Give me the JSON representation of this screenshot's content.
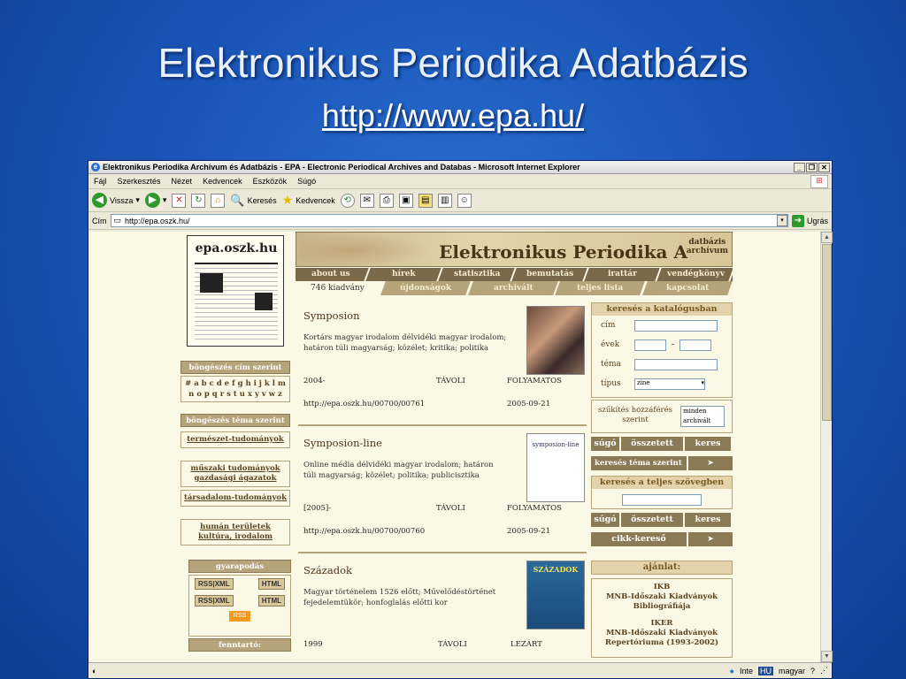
{
  "slide": {
    "title": "Elektronikus Periodika Adatbázis",
    "link": "http://www.epa.hu/"
  },
  "window": {
    "title": "Elektronikus Periodika Archívum és Adatbázis - EPA - Electronic Periodical Archives and Databas - Microsoft Internet Explorer",
    "menu": [
      "Fájl",
      "Szerkesztés",
      "Nézet",
      "Kedvencek",
      "Eszközök",
      "Súgó"
    ],
    "toolbar": {
      "back": "Vissza",
      "search": "Keresés",
      "favorites": "Kedvencek"
    },
    "address": {
      "label": "Cím",
      "url": "http://epa.oszk.hu/",
      "go": "Ugrás"
    },
    "status": {
      "zone": "Inte",
      "lang_code": "HU",
      "lang": "magyar"
    }
  },
  "site": {
    "logo_text": "epa.oszk.hu",
    "banner": {
      "title": "Elektronikus Periodika A",
      "sub1": "datbázis",
      "sub2": "archívum"
    },
    "nav_top": [
      "about us",
      "hírek",
      "statisztika",
      "bemutatás",
      "irattár",
      "vendégkönyv"
    ],
    "nav_bottom": [
      "746 kiadvány",
      "újdonságok",
      "archivált",
      "teljes lista",
      "kapcsolat"
    ],
    "left": {
      "browse_title": "böngészés cím szerint",
      "alpha1": "# a b c d e f g h i j k l m",
      "alpha2": "n o p q r s t u x y v w z",
      "browse_topic": "böngészés téma szerint",
      "topics": [
        "természet-tudományok",
        "műszaki tudományok gazdasági ágazatok",
        "társadalom-tudományok",
        "humán területek kultúra, irodalom"
      ],
      "gyarapodas": "gyarapodás",
      "rss": "RSS",
      "xml": "XML",
      "html": "HTML",
      "rss_badge": "RSS",
      "fenntarto": "fenntartó:"
    },
    "entries": [
      {
        "title": "Symposion",
        "desc": "Kortárs magyar irodalom délvidéki magyar irodalom; határon túli magyarság; közélet; kritika; politika",
        "year": "2004-",
        "access": "TÁVOLI",
        "status": "FOLYAMATOS",
        "url": "http://epa.oszk.hu/00700/00761",
        "date": "2005-09-21"
      },
      {
        "title": "Symposion-line",
        "desc": "Online média délvidéki magyar irodalom; határon túli magyarság; közélet; politika; publicisztika",
        "year": "[2005]-",
        "access": "TÁVOLI",
        "status": "FOLYAMATOS",
        "url": "http://epa.oszk.hu/00700/00760",
        "date": "2005-09-21",
        "thumb_text": "symposion-line"
      },
      {
        "title": "Századok",
        "desc": "Magyar történelem 1526 előtt; Művelődéstörténet fejedelemtükör; honfoglalás előtti kor",
        "year": "1999",
        "access": "TÁVOLI",
        "status": "LEZÁRT",
        "thumb_text": "SZÁZADOK"
      }
    ],
    "right": {
      "catalog_title": "keresés a katalógusban",
      "labels": [
        "cím",
        "évek",
        "téma",
        "típus"
      ],
      "year_dash": "-",
      "type_value": "zine",
      "access_label": "szűkítés hozzáférés szerint",
      "access_options": [
        "minden",
        "archivált"
      ],
      "help": "súgó",
      "advanced": "összetett",
      "search": "keres",
      "topic_search": "keresés téma szerint",
      "fulltext_title": "keresés a teljes szövegben",
      "article_search": "cikk-kereső",
      "recommend_title": "ajánlat:",
      "rec1_code": "IKB",
      "rec1_text": "MNB-Időszaki Kiadványok Bibliográfiája",
      "rec2_code": "IKER",
      "rec2_text": "MNB-Időszaki Kiadványok Repertóriuma (1993-2002)"
    }
  }
}
